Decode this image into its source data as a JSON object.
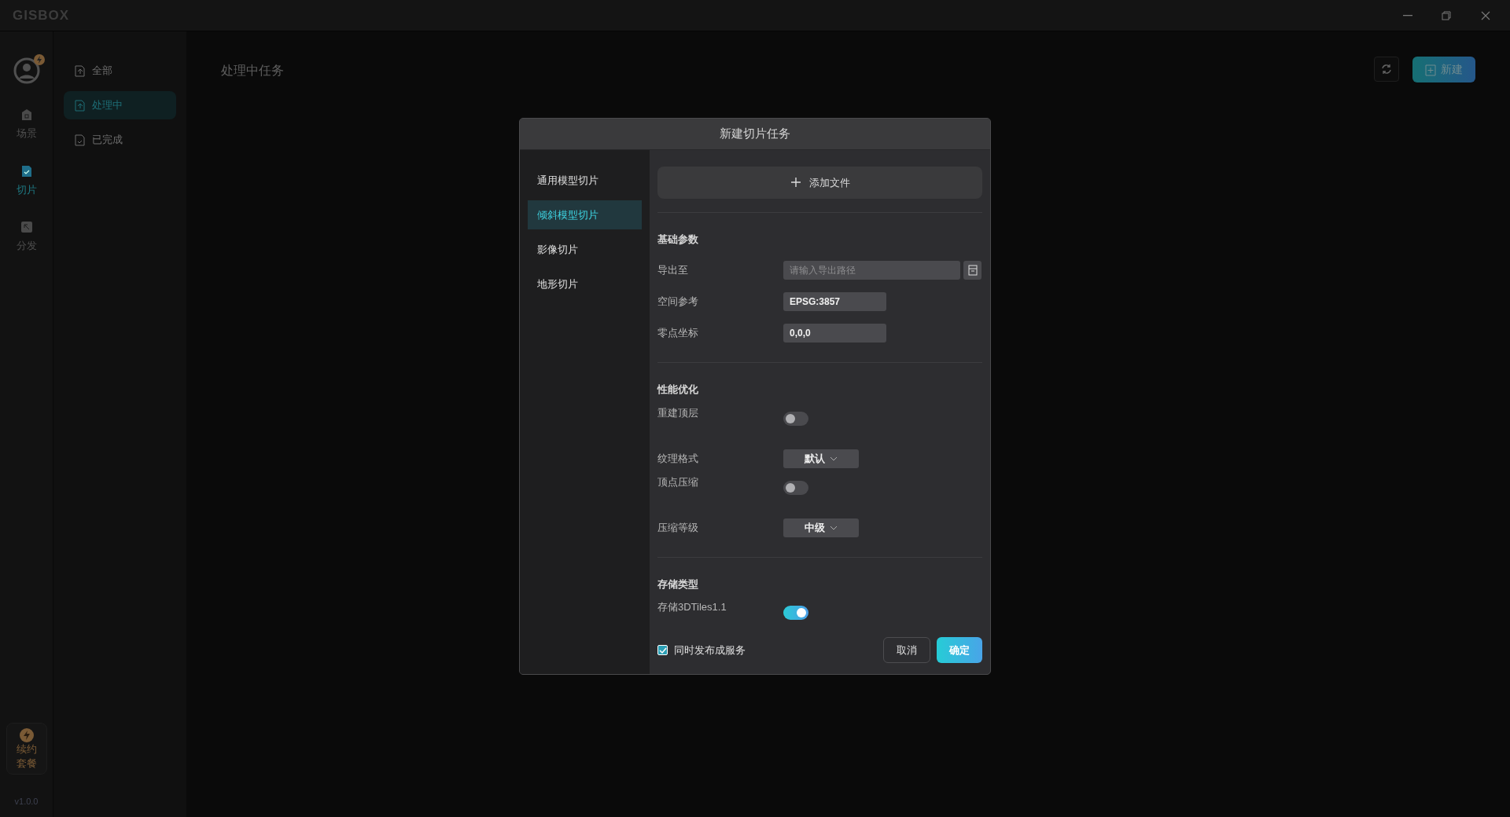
{
  "title_bar": {
    "logo": "GISBOX"
  },
  "rail": {
    "items": [
      {
        "label": "场景",
        "selected": false
      },
      {
        "label": "切片",
        "selected": true
      },
      {
        "label": "分发",
        "selected": false
      }
    ],
    "promo": {
      "lines": [
        "续约",
        "套餐"
      ]
    },
    "version": "v1.0.0"
  },
  "nav": {
    "items": [
      {
        "label": "全部",
        "selected": false
      },
      {
        "label": "处理中",
        "selected": true
      },
      {
        "label": "已完成",
        "selected": false
      }
    ]
  },
  "main": {
    "title": "处理中任务",
    "new_button": "新建"
  },
  "dialog": {
    "title": "新建切片任务",
    "menu": [
      {
        "label": "通用模型切片",
        "selected": false
      },
      {
        "label": "倾斜模型切片",
        "selected": true
      },
      {
        "label": "影像切片",
        "selected": false
      },
      {
        "label": "地形切片",
        "selected": false
      }
    ],
    "add_file": "添加文件",
    "sections": [
      {
        "title": "基础参数",
        "fields": [
          {
            "kind": "path",
            "label": "导出至",
            "placeholder": "请输入导出路径"
          },
          {
            "kind": "input",
            "label": "空间参考",
            "value": "EPSG:3857"
          },
          {
            "kind": "input",
            "label": "零点坐标",
            "value": "0,0,0"
          }
        ]
      },
      {
        "title": "性能优化",
        "fields": [
          {
            "kind": "toggle",
            "label": "重建顶层",
            "on": false
          },
          {
            "kind": "select",
            "label": "纹理格式",
            "value": "默认"
          },
          {
            "kind": "toggle",
            "label": "顶点压缩",
            "on": false
          },
          {
            "kind": "select",
            "label": "压缩等级",
            "value": "中级"
          }
        ]
      },
      {
        "title": "存储类型",
        "fields": [
          {
            "kind": "toggle",
            "label": "存储3DTiles1.1",
            "on": true
          }
        ]
      }
    ],
    "publish": {
      "label": "同时发布成服务",
      "checked": true
    },
    "cancel_button": "取消",
    "ok_button": "确定"
  }
}
